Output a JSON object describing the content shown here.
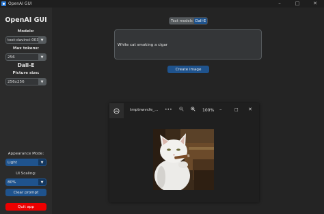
{
  "titlebar": {
    "title": "OpenAI GUI",
    "minimize_icon": "minimize-icon",
    "maximize_icon": "maximize-icon",
    "close_icon": "close-icon"
  },
  "sidebar": {
    "title": "OpenAI GUI",
    "models_label": "Models:",
    "model_value": "text-davinci-003",
    "max_tokens_label": "Max tokens:",
    "max_tokens_value": "256",
    "dalle_heading": "Dall-E",
    "picture_size_label": "Picture size:",
    "picture_size_value": "256x256",
    "appearance_label": "Appearance Mode:",
    "appearance_value": "Light",
    "scaling_label": "UI Scaling:",
    "scaling_value": "80%",
    "clear_button": "Clear prompt",
    "quit_button": "Quit app"
  },
  "main": {
    "tabs": [
      {
        "label": "Text models",
        "selected": false
      },
      {
        "label": "Dall-E",
        "selected": true
      }
    ],
    "prompt_text": "White cat smoking a cigar",
    "create_button": "Create image"
  },
  "viewer": {
    "file_name": "tmptnwvcfe_...",
    "more_icon": "more-icon",
    "zoom_out_icon": "zoom-out-icon",
    "zoom_in_icon": "zoom-in-icon",
    "zoom_level": "100%",
    "minimize_icon": "minimize-icon",
    "maximize_icon": "maximize-icon",
    "close_icon": "close-icon",
    "image_alt": "white-cat-with-cigar-photo"
  },
  "colors": {
    "accent": "#1f538d",
    "danger": "#ee0000",
    "sidebar_bg": "#2b2b2b",
    "main_bg": "#242424"
  }
}
